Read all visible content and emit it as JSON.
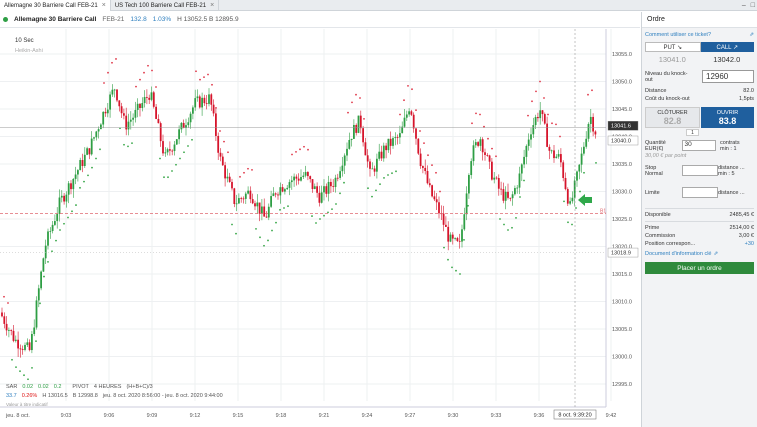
{
  "tabs": [
    {
      "label": "Allemagne 30 Barriere Call  FEB-21",
      "active": true
    },
    {
      "label": "US Tech 100 Barriere Call  FEB-21",
      "active": false
    }
  ],
  "window": {
    "minimize": "–",
    "maximize": "□"
  },
  "header": {
    "name": "Allemagne 30 Barriere Call",
    "code": "FEB-21",
    "change": "132.8",
    "change_pct": "1.03%",
    "high_low": "H 13052.5  B 12895.9"
  },
  "chart": {
    "interval": "10 Sec",
    "style": "Heikin-Ashi",
    "price_labels": [
      "13055.0",
      "13050.0",
      "13045.0",
      "13040.0",
      "13035.0",
      "13030.0",
      "13025.0",
      "13020.0",
      "13015.0",
      "13010.0",
      "13005.0",
      "13000.0",
      "12995.0"
    ],
    "highlight_prices": {
      "bid": "13041.6",
      "ask": "13040.0",
      "barrier": "13018.9"
    },
    "barrier_marker": "B1",
    "time_labels": [
      "9:03",
      "9:06",
      "9:09",
      "9:12",
      "9:15",
      "9:18",
      "9:21",
      "9:24",
      "9:27",
      "9:30",
      "9:33",
      "9:36",
      "9:42"
    ],
    "cursor_time": "8 oct. 9:39:20",
    "indicator_sar": {
      "name": "SAR",
      "v1": "0.02",
      "v2": "0.02",
      "v3": "0.2"
    },
    "indicator_pivot": {
      "name": "PIVOT",
      "period": "4 HEURES",
      "formula": "(H+B+C)/3"
    },
    "indicator_vals": [
      "33.7",
      "0.26%",
      "H 13016.5",
      "B 12998.8",
      "jeu. 8 oct. 2020 8:56:00 - jeu. 8 oct. 2020 9:44:00"
    ],
    "footnote": "Valeur à titre indicatif",
    "date_left": "jeu. 8 oct.",
    "colors": {
      "up": "#2e9e44",
      "down": "#d6142b",
      "sar_up": "#3aa84a",
      "sar_down": "#e0394a"
    }
  },
  "panel": {
    "title": "Ordre",
    "help_link": "Comment utiliser ce ticket?",
    "put_label": "PUT ↘",
    "call_label": "CALL ↗",
    "put_price": "13041.0",
    "call_price": "13042.0",
    "knockout_label": "Niveau du knock-out",
    "knockout_value": "12960",
    "distance_label": "Distance",
    "distance_value": "82.0",
    "cost_label": "Coût du knock-out",
    "cost_value": "1,5pts",
    "close_label": "CLÔTURER",
    "close_price": "82.8",
    "close_qty": "1",
    "open_label": "OUVRIR",
    "open_price": "83.8",
    "qty_label": "Quantité EUR(€)",
    "qty_value": "30",
    "contracts_label": "contrats",
    "contracts_min": "min : 1",
    "per_point": "30,00 € par point",
    "stop_label": "Stop",
    "stop_sub": "Normal",
    "stop_dist": "distance ...",
    "stop_min": "min : 5",
    "limit_label": "Limite",
    "limit_dist": "distance ...",
    "available_label": "Disponible",
    "available_value": "2485,45 €",
    "premium_label": "Prime",
    "premium_value": "2514,00 €",
    "commission_label": "Commission",
    "commission_value": "3,00 €",
    "position_label": "Position correspon...",
    "position_value": "+30",
    "doc_link": "Document d'information clé",
    "order_button": "Placer un ordre"
  }
}
